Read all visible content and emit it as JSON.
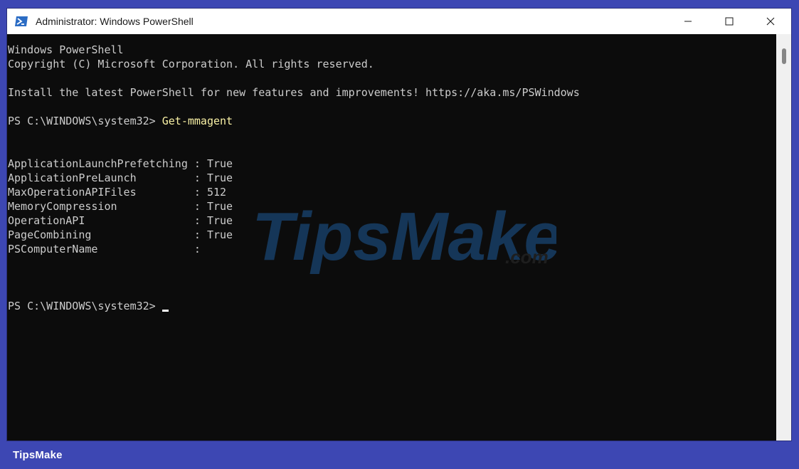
{
  "window": {
    "title": "Administrator: Windows PowerShell",
    "controls": {
      "minimize": "minimize-icon",
      "maximize": "maximize-icon",
      "close": "close-icon"
    }
  },
  "console": {
    "lines": [
      {
        "text": "Windows PowerShell"
      },
      {
        "text": "Copyright (C) Microsoft Corporation. All rights reserved."
      },
      {
        "text": ""
      },
      {
        "text": "Install the latest PowerShell for new features and improvements! https://aka.ms/PSWindows"
      },
      {
        "text": ""
      },
      {
        "prompt": "PS C:\\WINDOWS\\system32> ",
        "command": "Get-mmagent"
      },
      {
        "text": ""
      },
      {
        "text": ""
      },
      {
        "text": "ApplicationLaunchPrefetching : True"
      },
      {
        "text": "ApplicationPreLaunch         : True"
      },
      {
        "text": "MaxOperationAPIFiles         : 512"
      },
      {
        "text": "MemoryCompression            : True"
      },
      {
        "text": "OperationAPI                 : True"
      },
      {
        "text": "PageCombining                : True"
      },
      {
        "text": "PSComputerName               :"
      },
      {
        "text": ""
      },
      {
        "text": ""
      },
      {
        "text": ""
      },
      {
        "prompt": "PS C:\\WINDOWS\\system32> ",
        "command": "",
        "cursor": true
      }
    ]
  },
  "watermark": {
    "brand": "TipsMake",
    "suffix": ".com"
  },
  "footer": {
    "brand": "TipsMake"
  },
  "colors": {
    "frame": "#3d47b3",
    "console_bg": "#0c0c0c",
    "console_text": "#cccccc",
    "command_text": "#f9f1a5"
  }
}
